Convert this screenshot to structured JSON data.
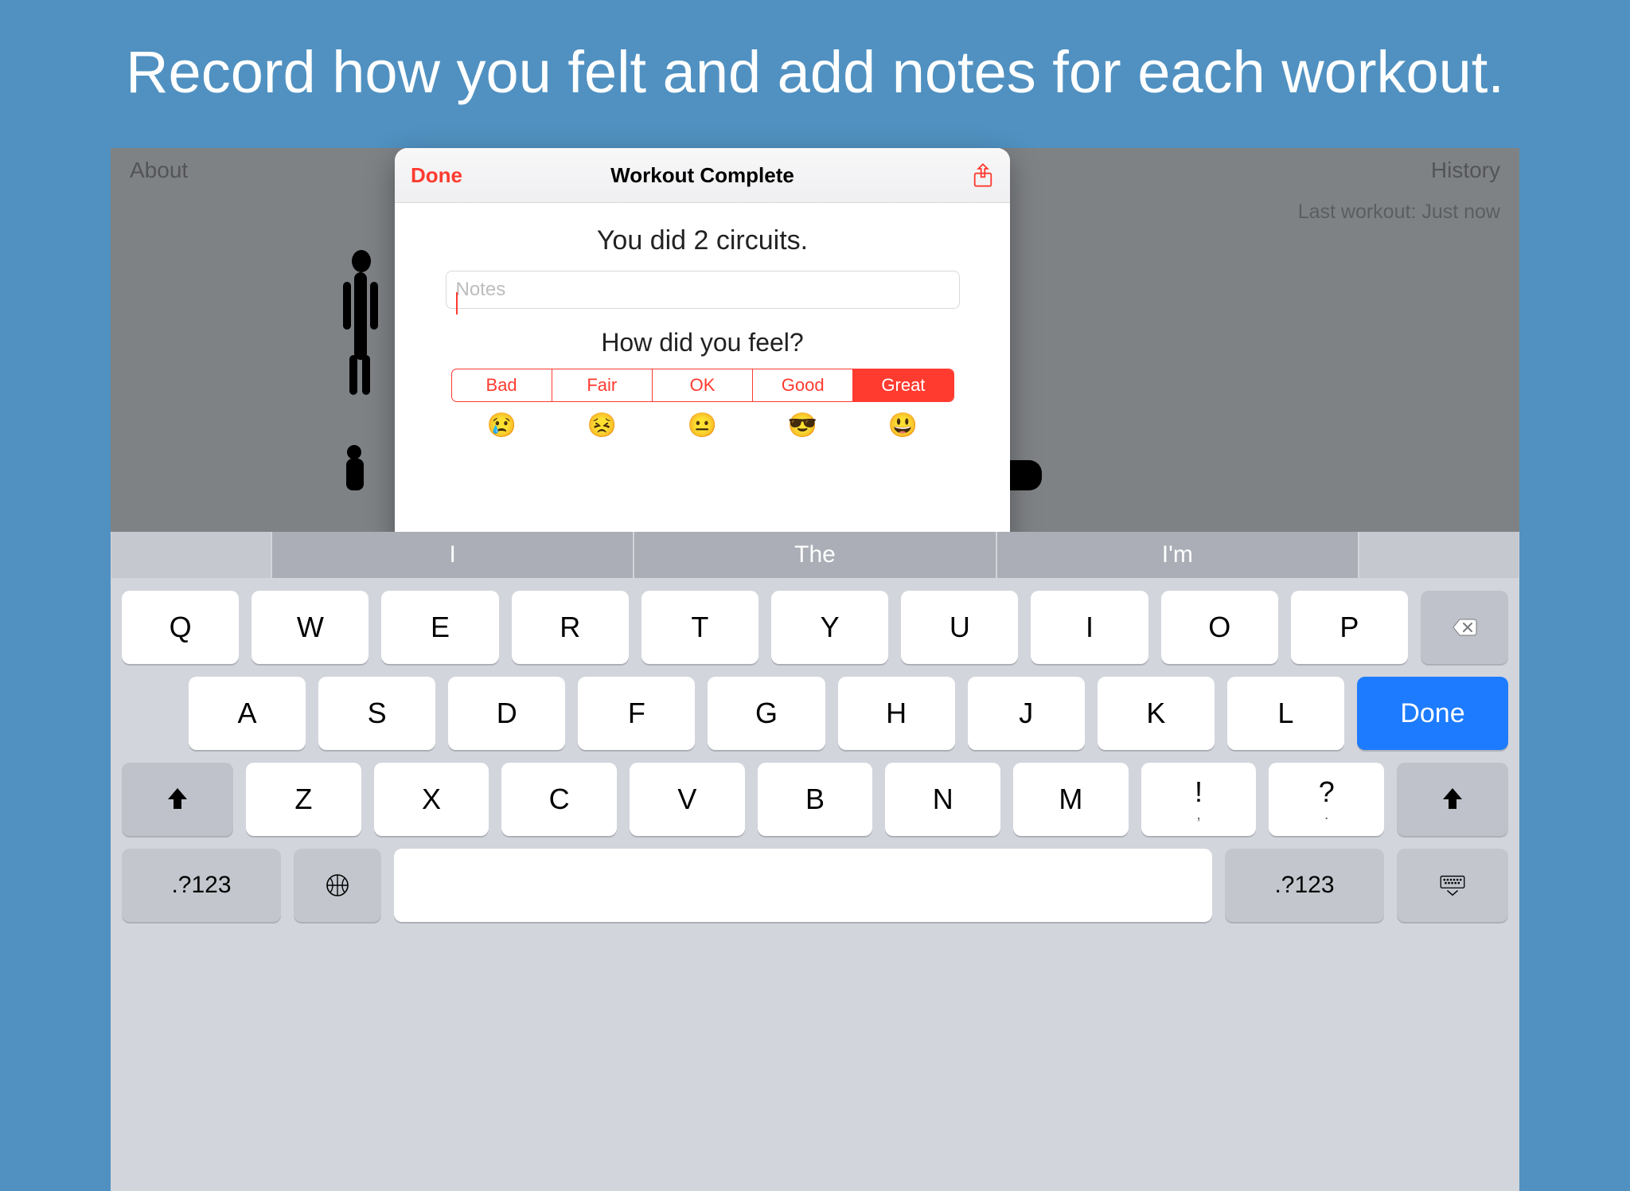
{
  "promo": {
    "headline": "Record how you felt and add notes for each workout."
  },
  "nav": {
    "left": "About",
    "right": "History",
    "last_workout": "Last workout: Just now"
  },
  "modal": {
    "done": "Done",
    "title": "Workout Complete",
    "circuits_text": "You did 2 circuits.",
    "notes_placeholder": "Notes",
    "notes_value": "",
    "feel_prompt": "How did you feel?",
    "ratings": [
      "Bad",
      "Fair",
      "OK",
      "Good",
      "Great"
    ],
    "rating_emoji": [
      "😢",
      "😣",
      "😐",
      "😎",
      "😃"
    ],
    "selected_index": 4
  },
  "keyboard": {
    "predictions": [
      "I",
      "The",
      "I'm"
    ],
    "row1": [
      "Q",
      "W",
      "E",
      "R",
      "T",
      "Y",
      "U",
      "I",
      "O",
      "P"
    ],
    "row2": [
      "A",
      "S",
      "D",
      "F",
      "G",
      "H",
      "J",
      "K",
      "L"
    ],
    "row3": [
      "Z",
      "X",
      "C",
      "V",
      "B",
      "N",
      "M"
    ],
    "punct": [
      {
        "top": "!",
        "bot": ","
      },
      {
        "top": "?",
        "bot": "."
      }
    ],
    "done_label": "Done",
    "numbers_label": ".?123"
  }
}
